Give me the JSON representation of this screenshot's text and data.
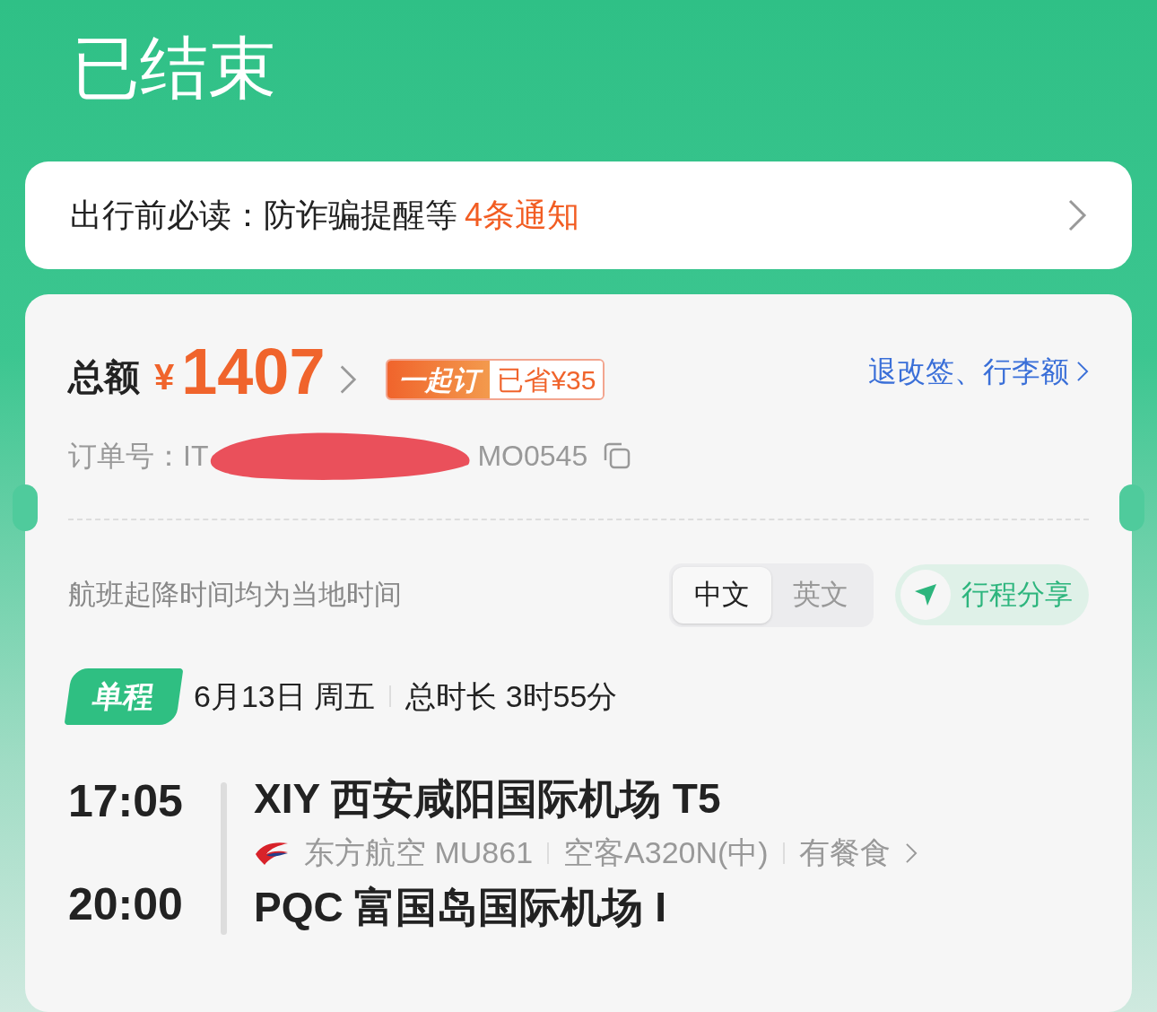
{
  "status_title": "已结束",
  "notice": {
    "label": "出行前必读：防诈骗提醒等",
    "highlight": "4条通知"
  },
  "total": {
    "label": "总额",
    "currency": "¥",
    "amount": "1407",
    "badge_tag": "一起订",
    "badge_text": "已省¥35",
    "link": "退改签、行李额"
  },
  "order": {
    "label": "订单号：",
    "visible_start": "IT",
    "visible_end": "MO0545"
  },
  "time_note": "航班起降时间均为当地时间",
  "languages": [
    {
      "label": "中文",
      "selected": true
    },
    {
      "label": "英文",
      "selected": false
    }
  ],
  "share": {
    "label": "行程分享"
  },
  "trip": {
    "tag": "单程",
    "date": "6月13日 周五",
    "duration": "总时长 3时55分"
  },
  "flight": {
    "depart_time": "17:05",
    "depart_airport": "XIY 西安咸阳国际机场 T5",
    "airline": "东方航空 MU861",
    "aircraft": "空客A320N(中)",
    "meal": "有餐食",
    "arrive_time": "20:00",
    "arrive_airport": "PQC 富国岛国际机场 I"
  }
}
